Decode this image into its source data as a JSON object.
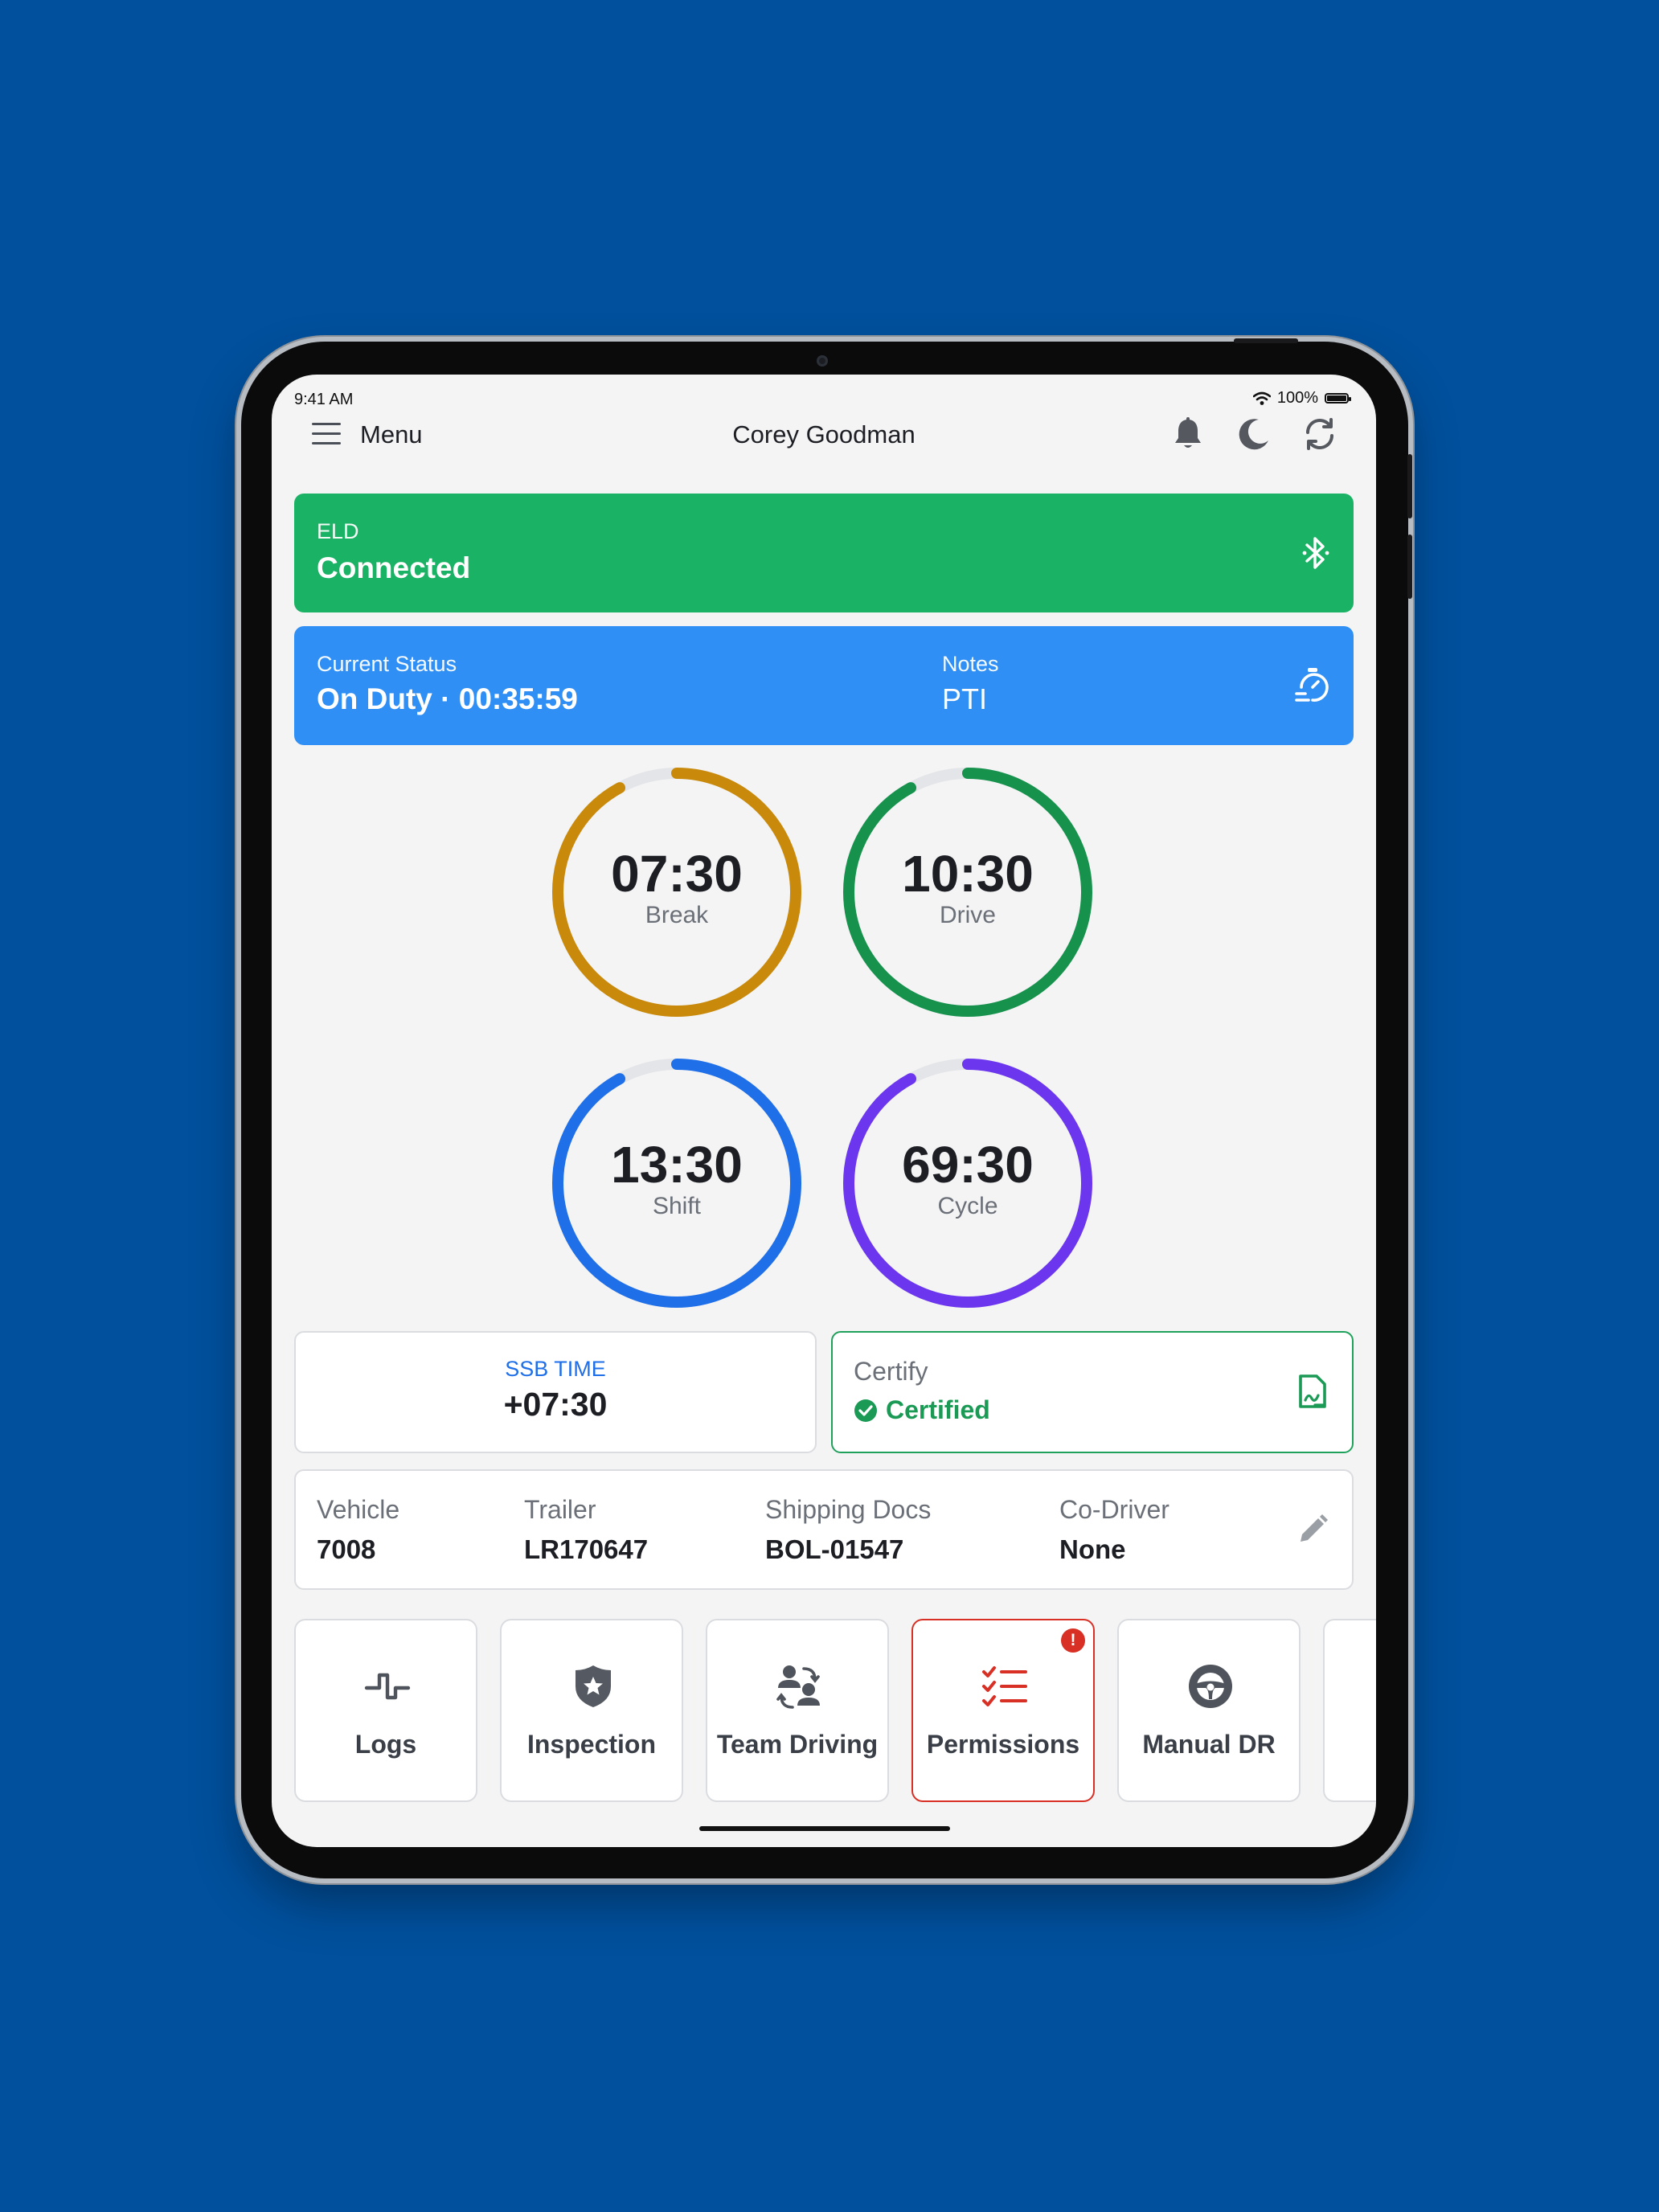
{
  "status_bar": {
    "time": "9:41 AM",
    "battery": "100%"
  },
  "header": {
    "menu_label": "Menu",
    "user_name": "Corey Goodman"
  },
  "eld": {
    "label": "ELD",
    "status": "Connected"
  },
  "current_status": {
    "label": "Current Status",
    "value": "On Duty · 00:35:59",
    "notes_label": "Notes",
    "notes_value": "PTI"
  },
  "timers": [
    {
      "value": "07:30",
      "label": "Break",
      "color": "#c98a0b",
      "progress": 0.92
    },
    {
      "value": "10:30",
      "label": "Drive",
      "color": "#16924d",
      "progress": 0.92
    },
    {
      "value": "13:30",
      "label": "Shift",
      "color": "#1f6fe8",
      "progress": 0.92
    },
    {
      "value": "69:30",
      "label": "Cycle",
      "color": "#6c36ee",
      "progress": 0.92
    }
  ],
  "ssb": {
    "label": "SSB TIME",
    "value": "+07:30"
  },
  "certify": {
    "label": "Certify",
    "status": "Certified"
  },
  "info": {
    "vehicle_label": "Vehicle",
    "vehicle_value": "7008",
    "trailer_label": "Trailer",
    "trailer_value": "LR170647",
    "docs_label": "Shipping Docs",
    "docs_value": "BOL-01547",
    "codriver_label": "Co-Driver",
    "codriver_value": "None"
  },
  "tiles": [
    {
      "label": "Logs",
      "icon": "logs-icon"
    },
    {
      "label": "Inspection",
      "icon": "badge-icon"
    },
    {
      "label": "Team Driving",
      "icon": "team-icon"
    },
    {
      "label": "Permissions",
      "icon": "checklist-icon",
      "alert": true
    },
    {
      "label": "Manual DR",
      "icon": "steering-wheel-icon"
    }
  ],
  "colors": {
    "background": "#00509d",
    "eld_green": "#1ab265",
    "status_blue": "#2f8ff5",
    "certified_green": "#20a15b",
    "alert_red": "#d93025"
  }
}
